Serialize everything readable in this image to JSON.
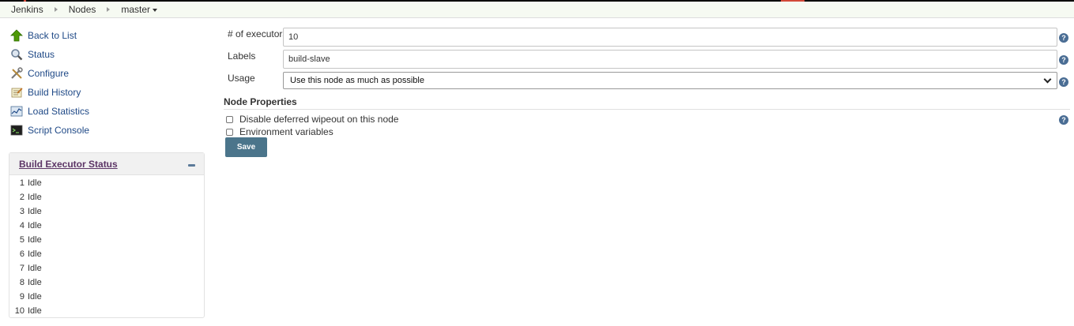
{
  "breadcrumb": {
    "items": [
      "Jenkins",
      "Nodes",
      "master"
    ]
  },
  "tasks": [
    {
      "label": "Back to List",
      "icon": "up-arrow-icon"
    },
    {
      "label": "Status",
      "icon": "magnifier-icon"
    },
    {
      "label": "Configure",
      "icon": "wrench-screwdriver-icon"
    },
    {
      "label": "Build History",
      "icon": "notepad-icon"
    },
    {
      "label": "Load Statistics",
      "icon": "graph-icon"
    },
    {
      "label": "Script Console",
      "icon": "terminal-icon"
    }
  ],
  "executor_status": {
    "title": "Build Executor Status",
    "rows": [
      {
        "num": "1",
        "state": "Idle"
      },
      {
        "num": "2",
        "state": "Idle"
      },
      {
        "num": "3",
        "state": "Idle"
      },
      {
        "num": "4",
        "state": "Idle"
      },
      {
        "num": "5",
        "state": "Idle"
      },
      {
        "num": "6",
        "state": "Idle"
      },
      {
        "num": "7",
        "state": "Idle"
      },
      {
        "num": "8",
        "state": "Idle"
      },
      {
        "num": "9",
        "state": "Idle"
      },
      {
        "num": "10",
        "state": "Idle"
      }
    ]
  },
  "form": {
    "executors_label": "# of executors",
    "executors_value": "10",
    "labels_label": "Labels",
    "labels_value": "build-slave",
    "usage_label": "Usage",
    "usage_value": "Use this node as much as possible",
    "node_properties_title": "Node Properties",
    "checkbox_wipeout": "Disable deferred wipeout on this node",
    "checkbox_env": "Environment variables",
    "save_label": "Save",
    "help_glyph": "?"
  },
  "colors": {
    "breadcrumb_bg": "#f6faf2",
    "link": "#204a87",
    "executor_title": "#5c3566",
    "save_button": "#4b758b",
    "help_icon": "#4a6d94",
    "top_accent": "#d24939"
  }
}
